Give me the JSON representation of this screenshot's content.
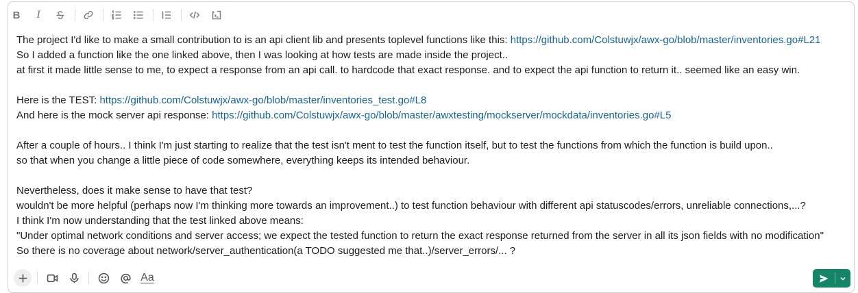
{
  "toolbar": {
    "bold_glyph": "B",
    "italic_glyph": "I",
    "icons": [
      "bold-icon",
      "italic-icon",
      "strikethrough-icon",
      "link-icon",
      "ordered-list-icon",
      "bulleted-list-icon",
      "blockquote-icon",
      "code-icon",
      "code-block-icon"
    ]
  },
  "message": {
    "line1_text": "The project I'd like to make a small contribution to is an api client lib and presents toplevel functions like this: ",
    "line1_link": "https://github.com/Colstuwjx/awx-go/blob/master/inventories.go#L21",
    "line2": "So I added a function like the one linked above, then I was looking at how tests are made inside the project..",
    "line3": "at first it made little sense to me, to expect a response from an api call. to hardcode that exact response. and to expect the api function to return it.. seemed like an easy win.",
    "line4_text": "Here is the TEST: ",
    "line4_link": "https://github.com/Colstuwjx/awx-go/blob/master/inventories_test.go#L8",
    "line5_text": "And here is the mock server api response: ",
    "line5_link": "https://github.com/Colstuwjx/awx-go/blob/master/awxtesting/mockserver/mockdata/inventories.go#L5",
    "line6": "After a couple of hours.. I think I'm just starting to realize that the test isn't ment to test the function itself, but to test the functions from which the function is build upon..",
    "line7": "so that when you change a little piece of code somewhere, everything keeps its intended behaviour.",
    "line8": "Nevertheless, does it make sense to have that test?",
    "line9": "wouldn't be more helpful (perhaps now I'm thinking more towards an improvement..) to test function behaviour with different api statuscodes/errors, unreliable connections,...?",
    "line10": "I think I'm now understanding that the test linked above means:",
    "line11": "\"Under optimal network conditions and server access; we expect the tested function to return the exact response returned from the server in all its json fields with no modification\"",
    "line12": "So there is no coverage about network/server_authentication(a TODO suggested me that..)/server_errors/... ?"
  },
  "bottom_bar": {
    "format_label": "Aa",
    "icons": [
      "plus-icon",
      "video-icon",
      "microphone-icon",
      "emoji-icon",
      "mention-icon",
      "text-format-icon"
    ]
  },
  "send": {
    "icons": [
      "send-icon",
      "chevron-down-icon"
    ],
    "color": "#148567"
  },
  "colors": {
    "link": "#1264a3",
    "text": "#1d1c1d"
  }
}
